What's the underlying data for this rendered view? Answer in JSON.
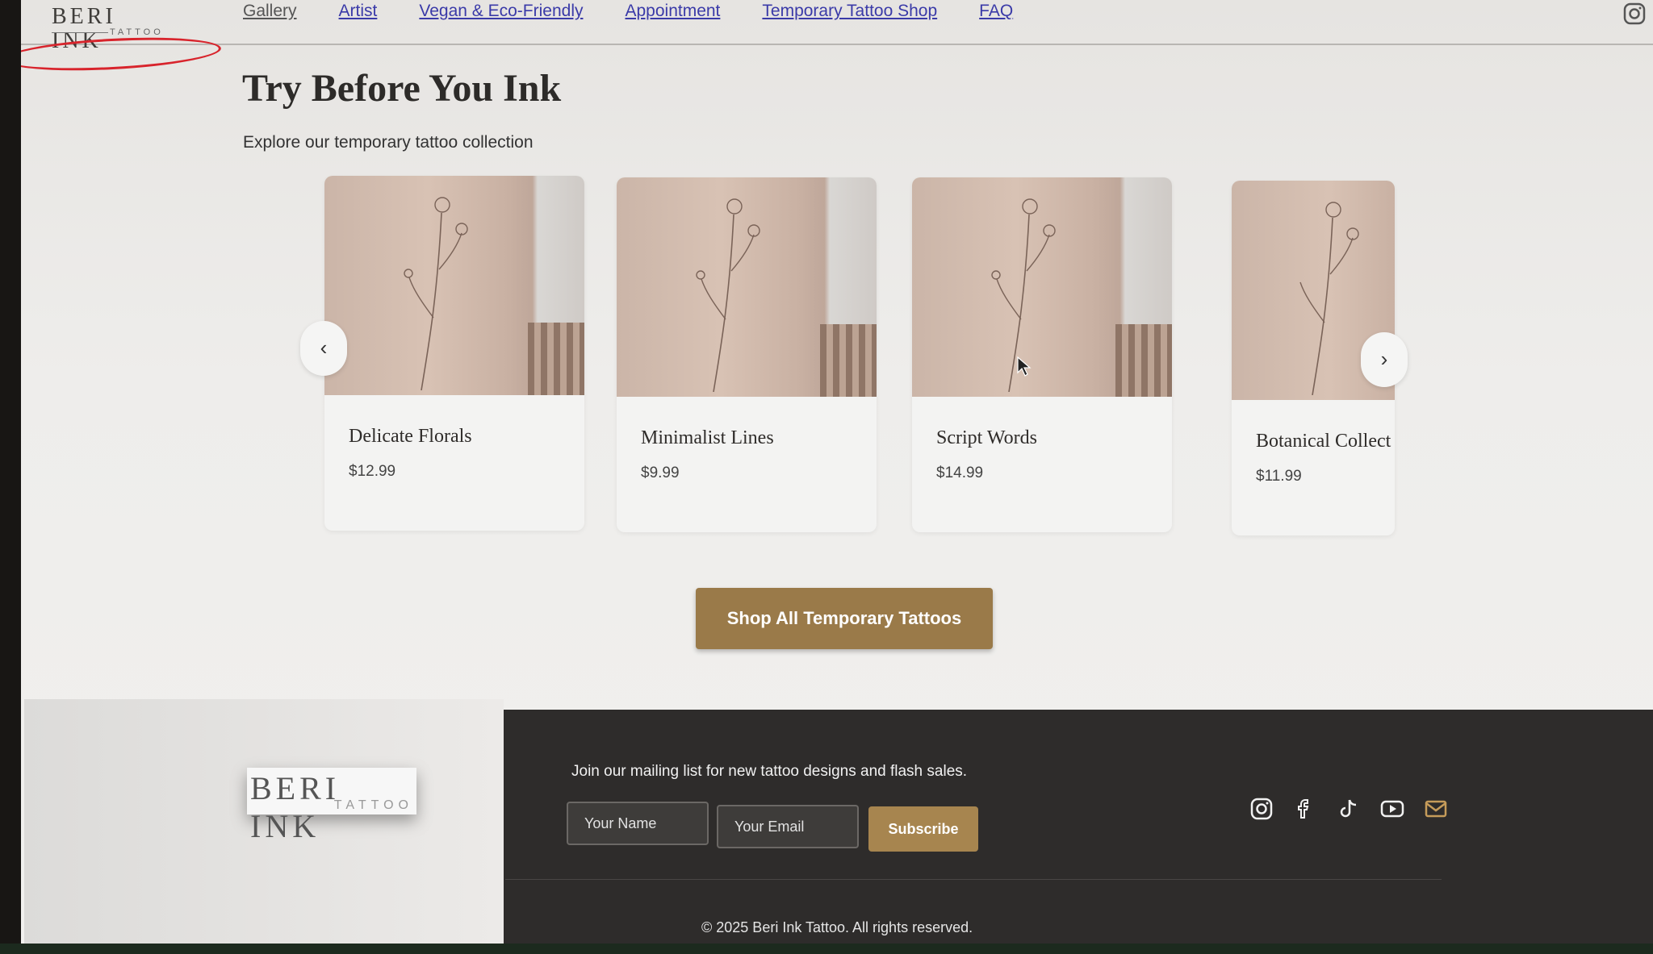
{
  "header": {
    "logo_main": "BERI INK",
    "logo_sub": "TATTOO",
    "nav": [
      "Gallery",
      "Artist",
      "Vegan & Eco-Friendly",
      "Appointment",
      "Temporary Tattoo Shop",
      "FAQ"
    ],
    "instagram_icon": "instagram-icon"
  },
  "hero": {
    "title": "Try Before You Ink",
    "subtitle": "Explore our temporary tattoo collection"
  },
  "products": [
    {
      "title": "Delicate Florals",
      "price": "$12.99"
    },
    {
      "title": "Minimalist Lines",
      "price": "$9.99"
    },
    {
      "title": "Script Words",
      "price": "$14.99"
    },
    {
      "title": "Botanical Collect",
      "price": "$11.99"
    }
  ],
  "carousel": {
    "prev": "‹",
    "next": "›"
  },
  "shop_button": "Shop All Temporary Tattoos",
  "footer": {
    "logo_main": "BERI INK",
    "logo_sub": "TATTOO",
    "mailing_text": "Join our mailing list for new tattoo designs and flash sales.",
    "name_placeholder": "Your Name",
    "email_placeholder": "Your Email",
    "subscribe": "Subscribe",
    "social_icons": [
      "instagram-icon",
      "facebook-icon",
      "tiktok-icon",
      "youtube-icon",
      "email-icon"
    ],
    "copyright": "© 2025 Beri Ink Tattoo. All rights reserved."
  },
  "colors": {
    "accent": "#9a7a49",
    "nav_link": "#3a3aa8",
    "footer_bg": "#2e2c2b",
    "annotation": "#d8242c"
  }
}
